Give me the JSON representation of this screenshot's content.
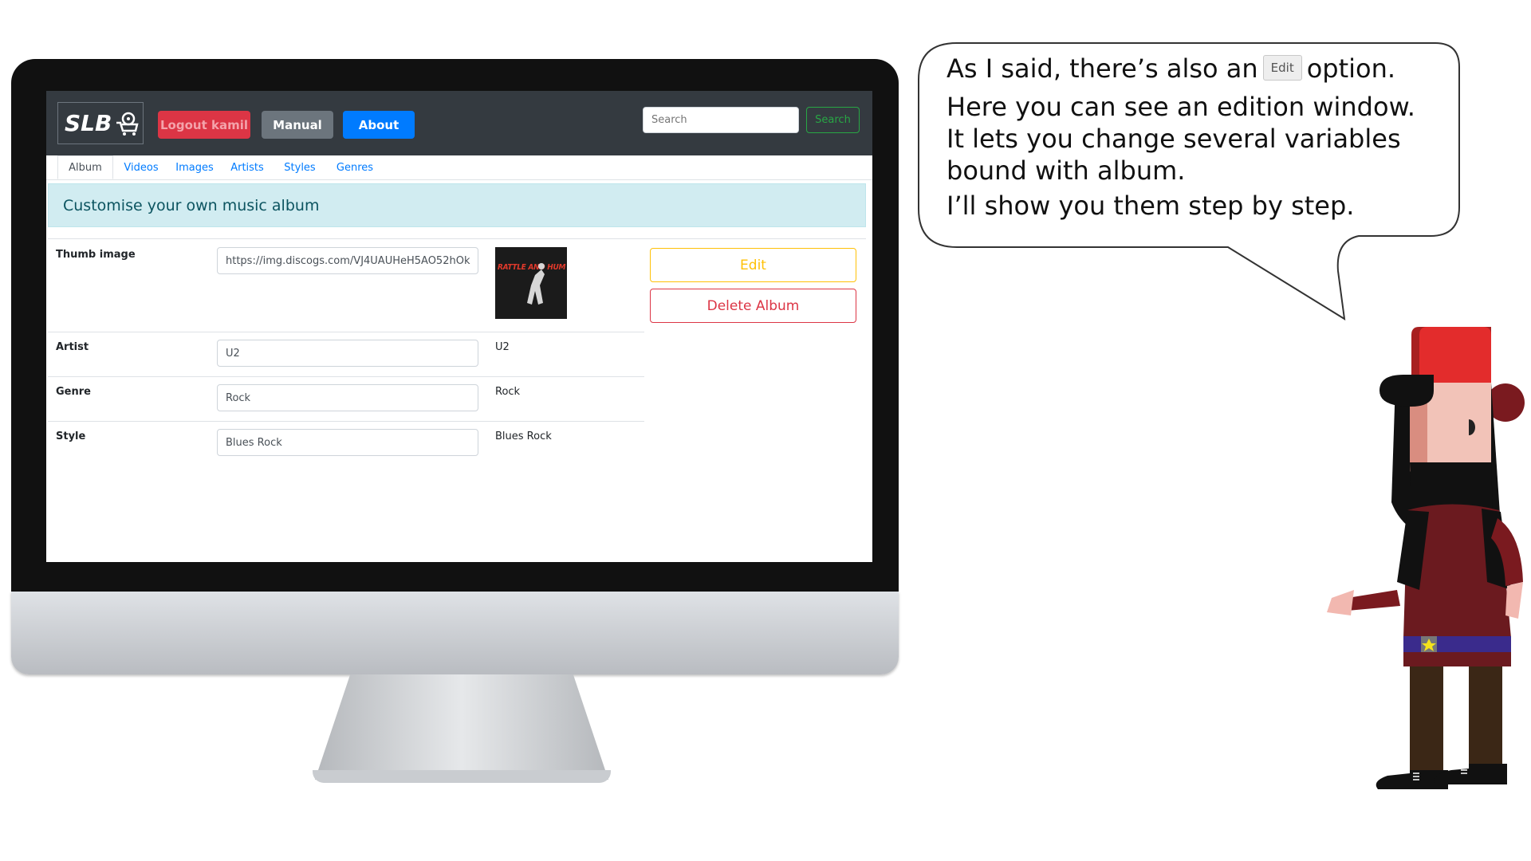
{
  "app": {
    "brand": "SLB",
    "nav": {
      "logout_label": "Logout kamil",
      "manual_label": "Manual",
      "about_label": "About",
      "search_placeholder": "Search",
      "search_button": "Search"
    },
    "tabs": [
      {
        "label": "Album",
        "active": true
      },
      {
        "label": "Videos",
        "active": false
      },
      {
        "label": "Images",
        "active": false
      },
      {
        "label": "Artists",
        "active": false
      },
      {
        "label": "Styles",
        "active": false
      },
      {
        "label": "Genres",
        "active": false
      }
    ],
    "alert": "Customise your own music album",
    "fields": [
      {
        "label": "Thumb image",
        "input": "https://img.discogs.com/VJ4UAUHeH5AO52hOk",
        "value": ""
      },
      {
        "label": "Artist",
        "input": "U2",
        "value": "U2"
      },
      {
        "label": "Genre",
        "input": "Rock",
        "value": "Rock"
      },
      {
        "label": "Style",
        "input": "Blues Rock",
        "value": "Blues Rock"
      }
    ],
    "album_cover_text": "RATTLE AND HUM",
    "actions": {
      "edit_label": "Edit",
      "delete_label": "Delete Album"
    }
  },
  "bubble": {
    "line1_before": "As I said, there’s also an",
    "line1_button": "Edit",
    "line1_after": "option.",
    "line2": "Here you can see an edition window.",
    "line3": "It lets you change several variables",
    "line4": "bound with album.",
    "line5": "I’ll show you them step by step."
  },
  "colors": {
    "navbar": "#343a40",
    "danger": "#dc3545",
    "secondary": "#6c757d",
    "primary": "#007bff",
    "success": "#28a745",
    "warning": "#ffc107",
    "info_bg": "#d1ecf1",
    "character_cap": "#e32c2c",
    "character_shirt": "#6b1a1f"
  }
}
